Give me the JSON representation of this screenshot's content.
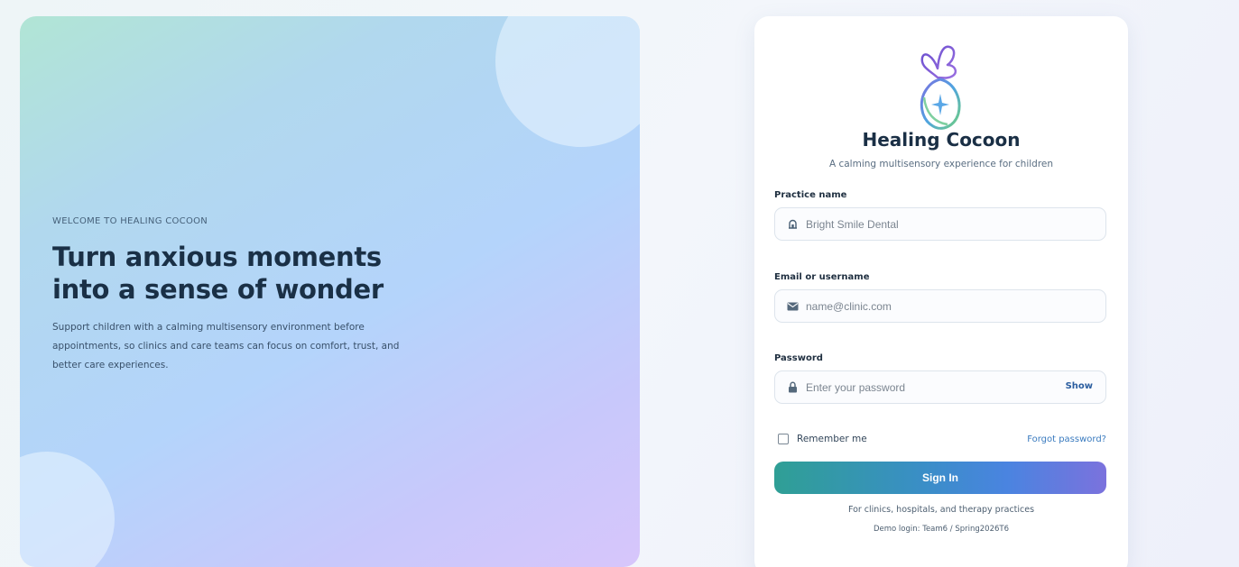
{
  "hero": {
    "eyebrow": "WELCOME TO HEALING COCOON",
    "headline_line1": "Turn anxious moments",
    "headline_line2": "into a sense of wonder",
    "description": "Support children with a calming multisensory environment before appointments, so clinics and care teams can focus on comfort, trust, and better care experiences."
  },
  "card": {
    "logo_icon": "butterfly-cocoon-logo",
    "brand": "Healing Cocoon",
    "tagline": "A calming multisensory experience for children",
    "practice": {
      "label": "Practice name",
      "placeholder": "Bright Smile Dental",
      "icon": "building-icon"
    },
    "email": {
      "label": "Email or username",
      "placeholder": "name@clinic.com",
      "icon": "envelope-icon"
    },
    "password": {
      "label": "Password",
      "placeholder": "Enter your password",
      "icon": "lock-icon",
      "show_label": "Show"
    },
    "remember_label": "Remember me",
    "remember_checked": false,
    "forgot_label": "Forgot password?",
    "signin_label": "Sign In",
    "footer_line1": "For clinics, hospitals, and therapy practices",
    "footer_line2": "Demo login: Team6 / Spring2026T6"
  },
  "colors": {
    "brand_dark": "#1a2f45",
    "link": "#3a7bbf",
    "button_start": "#2f9f95",
    "button_end": "#7b72dd"
  }
}
